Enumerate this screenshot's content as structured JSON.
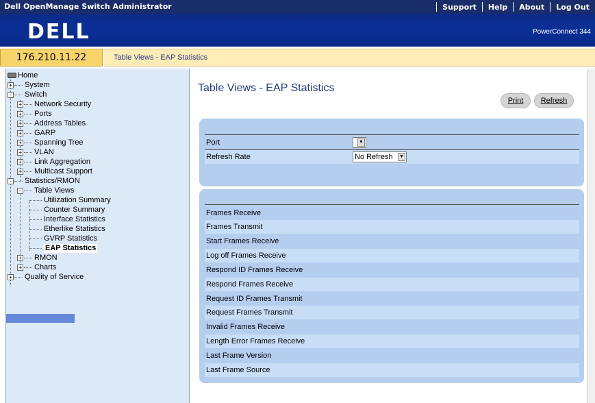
{
  "app_title": "Dell OpenManage Switch Administrator",
  "top_links": [
    "Support",
    "Help",
    "About",
    "Log Out"
  ],
  "brand": {
    "logo_text": "DELL",
    "model": "PowerConnect 344"
  },
  "ip_address": "176.210.11.22",
  "breadcrumb": "Table Views - EAP Statistics",
  "sidebar": {
    "items": [
      {
        "label": "Home"
      },
      {
        "label": "System"
      },
      {
        "label": "Switch"
      },
      {
        "label": "Network Security"
      },
      {
        "label": "Ports"
      },
      {
        "label": "Address Tables"
      },
      {
        "label": "GARP"
      },
      {
        "label": "Spanning Tree"
      },
      {
        "label": "VLAN"
      },
      {
        "label": "Link Aggregation"
      },
      {
        "label": "Multicast Support"
      },
      {
        "label": "Statistics/RMON"
      },
      {
        "label": "Table Views"
      },
      {
        "label": "Utilization Summary"
      },
      {
        "label": "Counter Summary"
      },
      {
        "label": "Interface Statistics"
      },
      {
        "label": "Etherlike Statistics"
      },
      {
        "label": "GVRP Statistics"
      },
      {
        "label": "EAP Statistics"
      },
      {
        "label": "RMON"
      },
      {
        "label": "Charts"
      },
      {
        "label": "Quality of Service"
      }
    ]
  },
  "main": {
    "title": "Table Views - EAP Statistics",
    "print_label": "Print",
    "refresh_label": "Refresh",
    "port_label": "Port",
    "port_value": "",
    "refresh_rate_label": "Refresh Rate",
    "refresh_rate_value": "No Refresh",
    "stats_rows": [
      "Frames Receive",
      "Frames Transmit",
      "Start Frames Receive",
      "Log off Frames Receive",
      "Respond ID Frames Receive",
      "Respond Frames Receive",
      "Request ID Frames Transmit",
      "Request Frames Transmit",
      "Invalid Frames Receive",
      "Length Error Frames Receive",
      "Last Frame Version",
      "Last Frame Source"
    ]
  },
  "colors": {
    "topbar": "#1a2d6b",
    "brandbar": "#0b2f96",
    "ipbox": "#f7d46a",
    "sidebar_bg": "#dce9f7",
    "panel": "#b5cdee",
    "title": "#223c8c"
  }
}
